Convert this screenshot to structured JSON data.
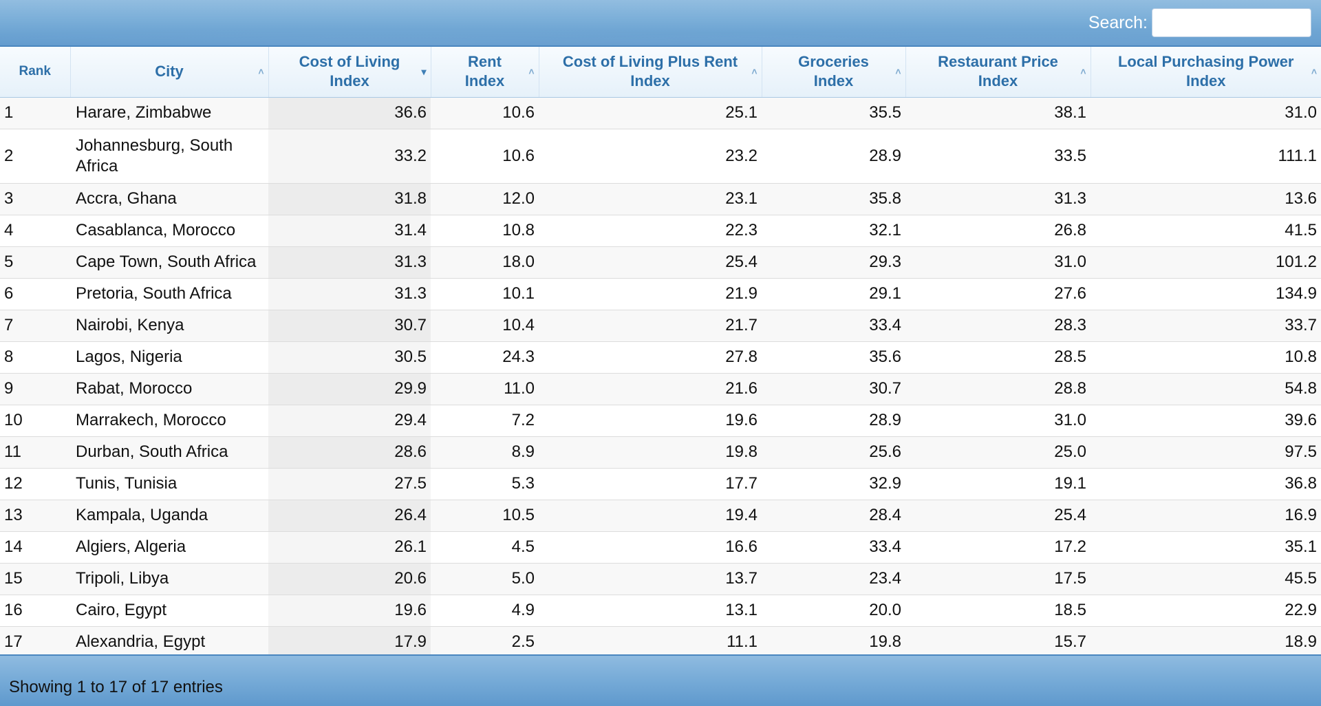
{
  "search": {
    "label": "Search:",
    "value": "",
    "placeholder": ""
  },
  "table": {
    "sorted_column": "Cost of Living Index",
    "sort_direction": "descending",
    "columns": [
      {
        "label": "Rank"
      },
      {
        "label": "City"
      },
      {
        "label": "Cost of Living Index"
      },
      {
        "label": "Rent Index"
      },
      {
        "label": "Cost of Living Plus Rent Index"
      },
      {
        "label": "Groceries Index"
      },
      {
        "label": "Restaurant Price Index"
      },
      {
        "label": "Local Purchasing Power Index"
      }
    ],
    "rows": [
      {
        "rank": "1",
        "city": "Harare, Zimbabwe",
        "col": "36.6",
        "rent": "10.6",
        "colr": "25.1",
        "groc": "35.5",
        "rest": "38.1",
        "lpp": "31.0"
      },
      {
        "rank": "2",
        "city": "Johannesburg, South Africa",
        "col": "33.2",
        "rent": "10.6",
        "colr": "23.2",
        "groc": "28.9",
        "rest": "33.5",
        "lpp": "111.1"
      },
      {
        "rank": "3",
        "city": "Accra, Ghana",
        "col": "31.8",
        "rent": "12.0",
        "colr": "23.1",
        "groc": "35.8",
        "rest": "31.3",
        "lpp": "13.6"
      },
      {
        "rank": "4",
        "city": "Casablanca, Morocco",
        "col": "31.4",
        "rent": "10.8",
        "colr": "22.3",
        "groc": "32.1",
        "rest": "26.8",
        "lpp": "41.5"
      },
      {
        "rank": "5",
        "city": "Cape Town, South Africa",
        "col": "31.3",
        "rent": "18.0",
        "colr": "25.4",
        "groc": "29.3",
        "rest": "31.0",
        "lpp": "101.2"
      },
      {
        "rank": "6",
        "city": "Pretoria, South Africa",
        "col": "31.3",
        "rent": "10.1",
        "colr": "21.9",
        "groc": "29.1",
        "rest": "27.6",
        "lpp": "134.9"
      },
      {
        "rank": "7",
        "city": "Nairobi, Kenya",
        "col": "30.7",
        "rent": "10.4",
        "colr": "21.7",
        "groc": "33.4",
        "rest": "28.3",
        "lpp": "33.7"
      },
      {
        "rank": "8",
        "city": "Lagos, Nigeria",
        "col": "30.5",
        "rent": "24.3",
        "colr": "27.8",
        "groc": "35.6",
        "rest": "28.5",
        "lpp": "10.8"
      },
      {
        "rank": "9",
        "city": "Rabat, Morocco",
        "col": "29.9",
        "rent": "11.0",
        "colr": "21.6",
        "groc": "30.7",
        "rest": "28.8",
        "lpp": "54.8"
      },
      {
        "rank": "10",
        "city": "Marrakech, Morocco",
        "col": "29.4",
        "rent": "7.2",
        "colr": "19.6",
        "groc": "28.9",
        "rest": "31.0",
        "lpp": "39.6"
      },
      {
        "rank": "11",
        "city": "Durban, South Africa",
        "col": "28.6",
        "rent": "8.9",
        "colr": "19.8",
        "groc": "25.6",
        "rest": "25.0",
        "lpp": "97.5"
      },
      {
        "rank": "12",
        "city": "Tunis, Tunisia",
        "col": "27.5",
        "rent": "5.3",
        "colr": "17.7",
        "groc": "32.9",
        "rest": "19.1",
        "lpp": "36.8"
      },
      {
        "rank": "13",
        "city": "Kampala, Uganda",
        "col": "26.4",
        "rent": "10.5",
        "colr": "19.4",
        "groc": "28.4",
        "rest": "25.4",
        "lpp": "16.9"
      },
      {
        "rank": "14",
        "city": "Algiers, Algeria",
        "col": "26.1",
        "rent": "4.5",
        "colr": "16.6",
        "groc": "33.4",
        "rest": "17.2",
        "lpp": "35.1"
      },
      {
        "rank": "15",
        "city": "Tripoli, Libya",
        "col": "20.6",
        "rent": "5.0",
        "colr": "13.7",
        "groc": "23.4",
        "rest": "17.5",
        "lpp": "45.5"
      },
      {
        "rank": "16",
        "city": "Cairo, Egypt",
        "col": "19.6",
        "rent": "4.9",
        "colr": "13.1",
        "groc": "20.0",
        "rest": "18.5",
        "lpp": "22.9"
      },
      {
        "rank": "17",
        "city": "Alexandria, Egypt",
        "col": "17.9",
        "rent": "2.5",
        "colr": "11.1",
        "groc": "19.8",
        "rest": "15.7",
        "lpp": "18.9"
      }
    ]
  },
  "footer": {
    "info": "Showing 1 to 17 of 17 entries"
  },
  "colors": {
    "bar_light": "#92bde0",
    "bar_dark": "#5f99cd",
    "header_text": "#2d6fa8",
    "row_odd": "#f8f8f8",
    "sorted_col": "#ececec"
  }
}
